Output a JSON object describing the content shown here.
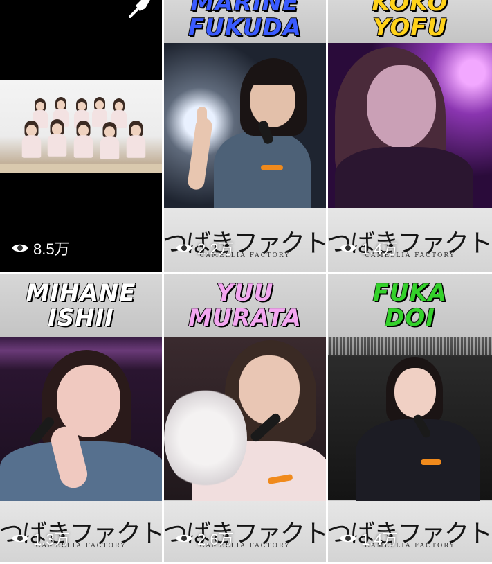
{
  "tiles": [
    {
      "kind": "video",
      "pinned": true,
      "views": "8.5万",
      "icons": {
        "pin": "pin-icon",
        "views": "eye-icon"
      }
    },
    {
      "kind": "member",
      "name_lines": [
        "MARINE",
        "FUKUDA"
      ],
      "name_color": "#3a5bff",
      "logo": "つばきファクトリー",
      "logo_sub": "CAMELLIA FACTORY",
      "views": "2.2万"
    },
    {
      "kind": "member",
      "name_lines": [
        "KOKO",
        "YOFU"
      ],
      "name_color": "#ffd21a",
      "logo": "つばきファクトリー",
      "logo_sub": "CAMELLIA FACTORY",
      "views": "1.4万"
    },
    {
      "kind": "member",
      "name_lines": [
        "MIHANE",
        "ISHII"
      ],
      "name_color": "#ffffff",
      "logo": "つばきファクトリー",
      "logo_sub": "CAMELLIA FACTORY",
      "views": "1.3万"
    },
    {
      "kind": "member",
      "name_lines": [
        "YUU",
        "MURATA"
      ],
      "name_color": "#f3a6f0",
      "logo": "つばきファクトリー",
      "logo_sub": "CAMELLIA FACTORY",
      "views": "2.6万"
    },
    {
      "kind": "member",
      "name_lines": [
        "FUKA",
        "DOI"
      ],
      "name_color": "#34d12b",
      "logo": "つばきファクトリー",
      "logo_sub": "CAMELLIA FACTORY",
      "views": "1.4万"
    }
  ]
}
